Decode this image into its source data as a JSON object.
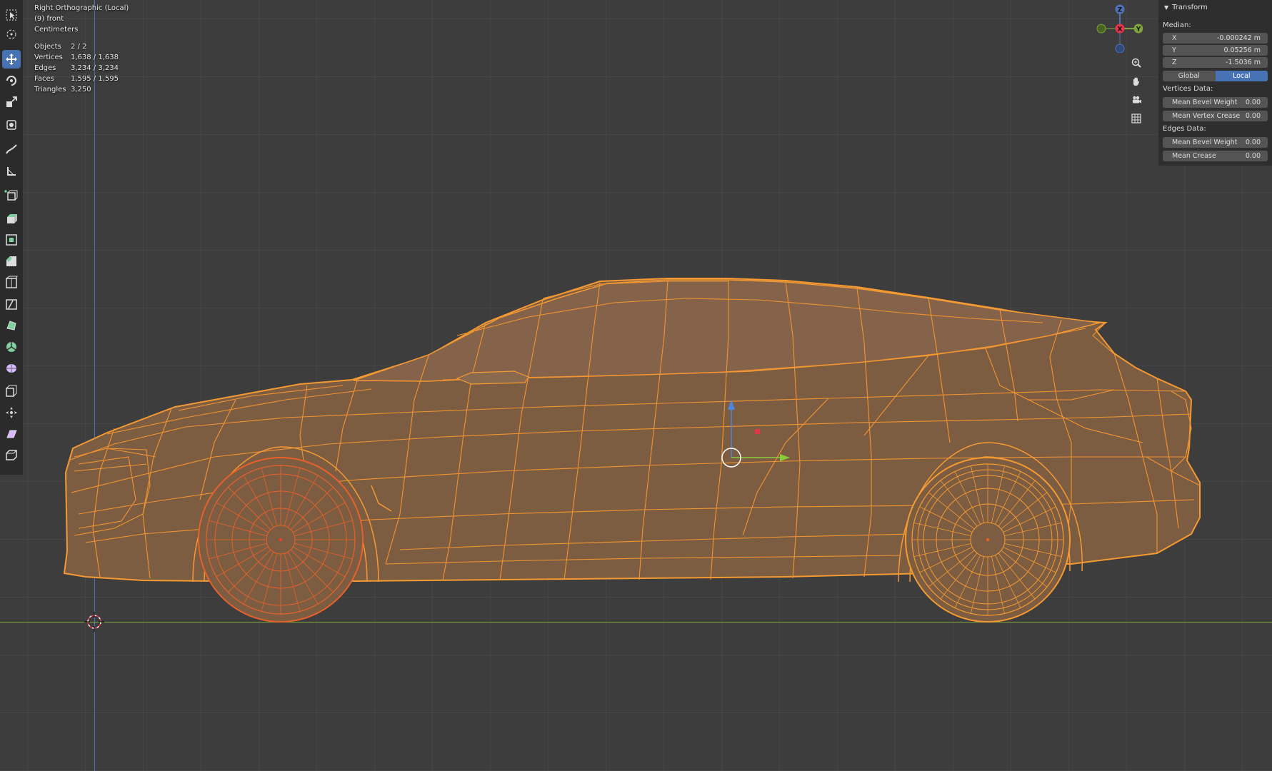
{
  "viewport": {
    "view_name": "Right Orthographic (Local)",
    "collection_object": "(9) front",
    "units": "Centimeters"
  },
  "stats": [
    {
      "label": "Objects",
      "value": "2 / 2"
    },
    {
      "label": "Vertices",
      "value": "1,638 / 1,638"
    },
    {
      "label": "Edges",
      "value": "3,234 / 3,234"
    },
    {
      "label": "Faces",
      "value": "1,595 / 1,595"
    },
    {
      "label": "Triangles",
      "value": "3,250"
    }
  ],
  "toolbar": {
    "tools": [
      "select-box-icon",
      "cursor-icon",
      "move-icon",
      "rotate-icon",
      "scale-icon",
      "transform-icon",
      "annotate-icon",
      "measure-icon",
      "add-cube-icon",
      "extrude-icon",
      "inset-icon",
      "bevel-icon",
      "loop-cut-icon",
      "knife-icon",
      "poly-build-icon",
      "spin-icon",
      "smooth-icon",
      "edge-slide-icon",
      "shrink-fatten-icon",
      "shear-icon",
      "rip-region-icon"
    ],
    "active_index": 2
  },
  "gizmo": {
    "x_label": "X",
    "y_label": "Y",
    "z_label": "Z"
  },
  "nav_buttons": [
    "zoom-icon",
    "pan-hand-icon",
    "camera-icon",
    "grid-ortho-icon"
  ],
  "transform_panel": {
    "title": "Transform",
    "median_label": "Median:",
    "x": {
      "label": "X",
      "value": "-0.000242 m"
    },
    "y": {
      "label": "Y",
      "value": "0.05256 m"
    },
    "z": {
      "label": "Z",
      "value": "-1.5036 m"
    },
    "space_global": "Global",
    "space_local": "Local",
    "vertices_data_label": "Vertices Data:",
    "mean_bevel_weight_v": {
      "label": "Mean Bevel Weight",
      "value": "0.00"
    },
    "mean_vertex_crease": {
      "label": "Mean Vertex Crease",
      "value": "0.00"
    },
    "edges_data_label": "Edges Data:",
    "mean_bevel_weight_e": {
      "label": "Mean Bevel Weight",
      "value": "0.00"
    },
    "mean_crease": {
      "label": "Mean Crease",
      "value": "0.00"
    }
  },
  "colors": {
    "accent": "#4772b3",
    "selection": "#f5a338",
    "axis_x": "#e5354b",
    "axis_y": "#7ea43c",
    "axis_z": "#4f73b8"
  }
}
